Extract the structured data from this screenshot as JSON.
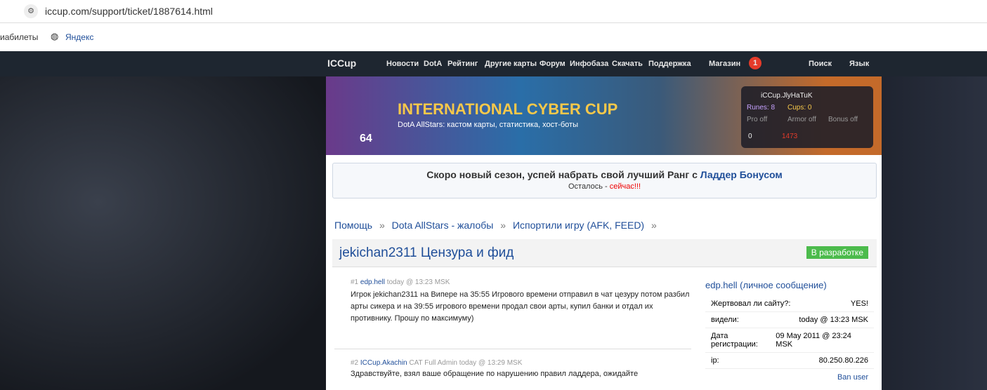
{
  "browser": {
    "url": "iccup.com/support/ticket/1887614.html",
    "bookmarks": [
      "иабилеты",
      "Яндекс"
    ]
  },
  "nav": {
    "logo": "ICCup",
    "items": [
      "Новости",
      "DotA",
      "Рейтинг",
      "Другие карты",
      "Форум",
      "Инфобаза",
      "Скачать",
      "Поддержка",
      "Магазин"
    ],
    "notif": "1",
    "search": "Поиск",
    "lang": "Язык"
  },
  "banner": {
    "title": "INTERNATIONAL CYBER CUP",
    "subtitle": "DotA AllStars: кастом карты, статистика, хост-боты",
    "level": "64"
  },
  "user": {
    "name": "iCCup.JlyHaTuK",
    "runes": "Runes: 8",
    "cups": "Cups: 0",
    "pro": "Pro off",
    "armor": "Armor off",
    "bonus": "Bonus off",
    "mail": "0",
    "alerts": "1473"
  },
  "announce": {
    "text": "Скоро новый сезон, успей набрать свой лучший Ранг с ",
    "link": "Ладдер Бонусом",
    "remain": "Осталось - ",
    "now": "сейчас!!!"
  },
  "crumbs": [
    "Помощь",
    "»",
    "Dota AllStars - жалобы",
    "»",
    "Испортили игру (AFK, FEED)",
    "»"
  ],
  "ticket": {
    "title": "jekichan2311 Цензура и фид",
    "status": "В разработке"
  },
  "posts": [
    {
      "num": "#1",
      "author": "edp.hell",
      "role": "",
      "time": "today @ 13:23 MSK",
      "text": "Игрок jekichan2311 на Випере на 35:55 Игрового времени отправил в чат цезуру потом разбил арты сикера и на 39:55 игрового времени продал свои арты, купил банки и отдал их противнику. Прошу по максимуму)"
    },
    {
      "num": "#2",
      "author": "ICCup.Akachin",
      "role": "CAT Full Admin",
      "time": "today @ 13:29 MSK",
      "text": "Здравствуйте, взял ваше обращение по нарушению правил ладдера, ожидайте"
    }
  ],
  "side": {
    "name": "edp.hell",
    "pm": "(личное сообщение)",
    "rows": [
      [
        "Жертвовал ли сайту?:",
        "YES!"
      ],
      [
        "видели:",
        "today @ 13:23 MSK"
      ],
      [
        "Дата регистрации:",
        "09 May 2011 @ 23:24 MSK"
      ],
      [
        "ip:",
        "80.250.80.226"
      ]
    ],
    "ban": "Ban user"
  },
  "colors": {
    "status": "#4cbb4c",
    "link": "#1f4e99",
    "nav": "#1e2630"
  }
}
